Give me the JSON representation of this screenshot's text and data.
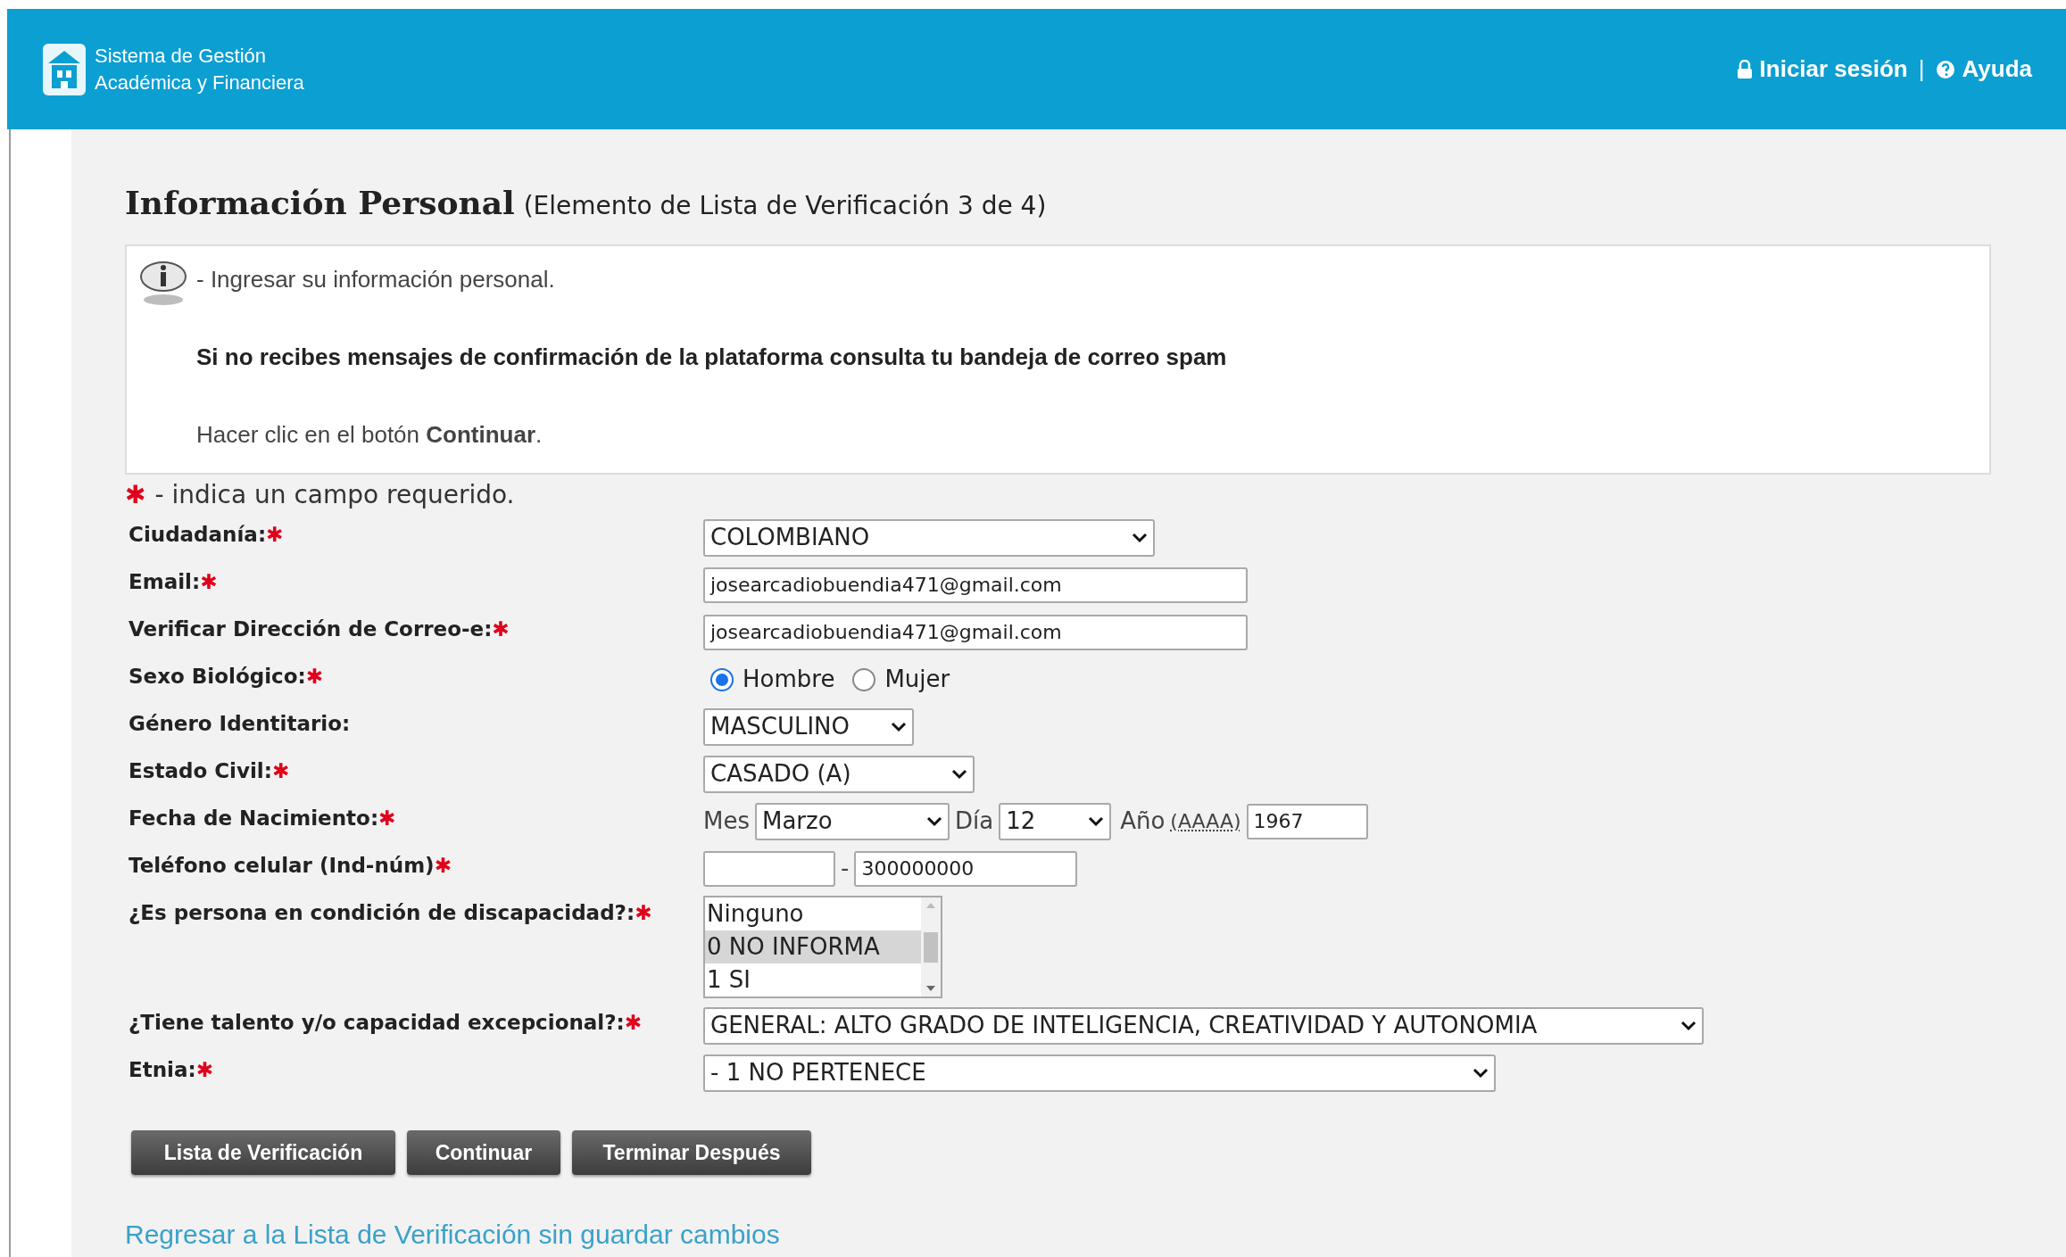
{
  "header": {
    "logo_lines": [
      "Sistema de Gestión",
      "Académica y Financiera"
    ],
    "links": [
      {
        "kind": "lock",
        "label": "Iniciar sesión"
      },
      {
        "kind": "help",
        "label": "Ayuda"
      }
    ],
    "separator": "|"
  },
  "page": {
    "title": "Información Personal",
    "subtitle": "(Elemento de Lista de Verificación 3 de 4)"
  },
  "info_box": {
    "lines": [
      "- Ingresar su información personal.",
      "Si no recibes mensajes de confirmación de la plataforma consulta tu bandeja de correo spam",
      "Hacer clic en el botón **Continuar**."
    ]
  },
  "required_note": {
    "mark": "✱",
    "text": "- indica un campo requerido."
  },
  "fields": [
    {
      "kind": "select",
      "label": "Ciudadanía:",
      "mark": "✱",
      "value": "COLOMBIANO"
    },
    {
      "kind": "input",
      "label": "Email:",
      "mark": "✱",
      "value": "josearcadiobuendia471@gmail.com"
    },
    {
      "kind": "input",
      "label": "Verificar Dirección de Correo-e:",
      "mark": "✱",
      "value": "josearcadiobuendia471@gmail.com"
    },
    {
      "kind": "radio",
      "label": "Sexo Biológico:",
      "mark": "✱",
      "options": [
        {
          "label": "Hombre",
          "selected": true
        },
        {
          "label": "Mujer",
          "selected": false
        }
      ]
    },
    {
      "kind": "select",
      "label": "Género Identitario:",
      "value": "MASCULINO"
    },
    {
      "kind": "select",
      "label": "Estado Civil:",
      "mark": "✱",
      "value": "CASADO (A)"
    },
    {
      "kind": "date",
      "label": "Fecha de Nacimiento:",
      "mark": "✱",
      "month_label": "Mes",
      "month": "Marzo",
      "day_label": "Día",
      "day": "12",
      "year_label": "Año",
      "year_hint": "(AAAA)",
      "year": "1967"
    },
    {
      "kind": "phone",
      "label": "Teléfono celular (Ind-núm)",
      "mark": "✱",
      "separator": "-",
      "number": "300000000"
    },
    {
      "kind": "listbox",
      "label": "¿Es persona en condición de discapacidad?:",
      "mark": "✱",
      "options": [
        {
          "label": "Ninguno",
          "selected": false
        },
        {
          "label": "0 NO INFORMA",
          "selected": true
        },
        {
          "label": "1 SI",
          "selected": false
        }
      ]
    },
    {
      "kind": "select",
      "label": "¿Tiene talento y/o capacidad excepcional?:",
      "mark": "✱",
      "value": "GENERAL: ALTO GRADO DE INTELIGENCIA, CREATIVIDAD Y AUTONOMIA"
    },
    {
      "kind": "select",
      "label": "Etnia:",
      "mark": "✱",
      "value": "- 1 NO PERTENECE"
    }
  ],
  "buttons": [
    "Lista de Verificación",
    "Continuar",
    "Terminar Después"
  ],
  "back_link": "Regresar a la Lista de Verificación sin guardar cambios"
}
